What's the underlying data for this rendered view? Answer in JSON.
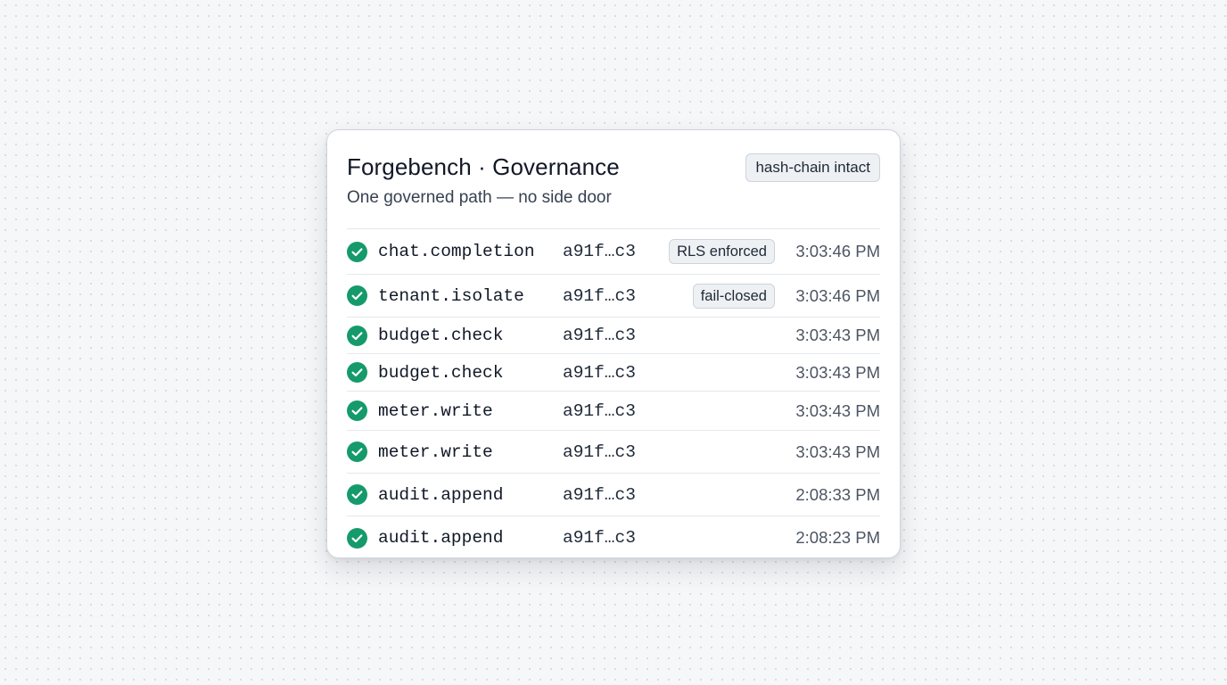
{
  "card": {
    "title": "Forgebench · Governance",
    "subtitle": "One governed path — no side door",
    "status_badge": "hash-chain intact"
  },
  "status_color": "#159a6c",
  "rows": [
    {
      "icon": "check-circle-icon",
      "event": "chat.completion",
      "hash": "a91f…c3",
      "tag": "RLS enforced",
      "time": "3:03:46 PM"
    },
    {
      "icon": "check-circle-icon",
      "event": "tenant.isolate",
      "hash": "a91f…c3",
      "tag": "fail-closed",
      "time": "3:03:46 PM"
    },
    {
      "icon": "check-circle-icon",
      "event": "budget.check",
      "hash": "a91f…c3",
      "time": "3:03:43 PM"
    },
    {
      "icon": "check-circle-icon",
      "event": "budget.check",
      "hash": "a91f…c3",
      "time": "3:03:43 PM"
    },
    {
      "icon": "check-circle-icon",
      "event": "meter.write",
      "hash": "a91f…c3",
      "time": "3:03:43 PM"
    },
    {
      "icon": "check-circle-icon",
      "event": "meter.write",
      "hash": "a91f…c3",
      "time": "3:03:43 PM"
    },
    {
      "icon": "check-circle-icon",
      "event": "audit.append",
      "hash": "a91f…c3",
      "time": "2:08:33 PM"
    },
    {
      "icon": "check-circle-icon",
      "event": "audit.append",
      "hash": "a91f…c3",
      "time": "2:08:23 PM"
    }
  ]
}
